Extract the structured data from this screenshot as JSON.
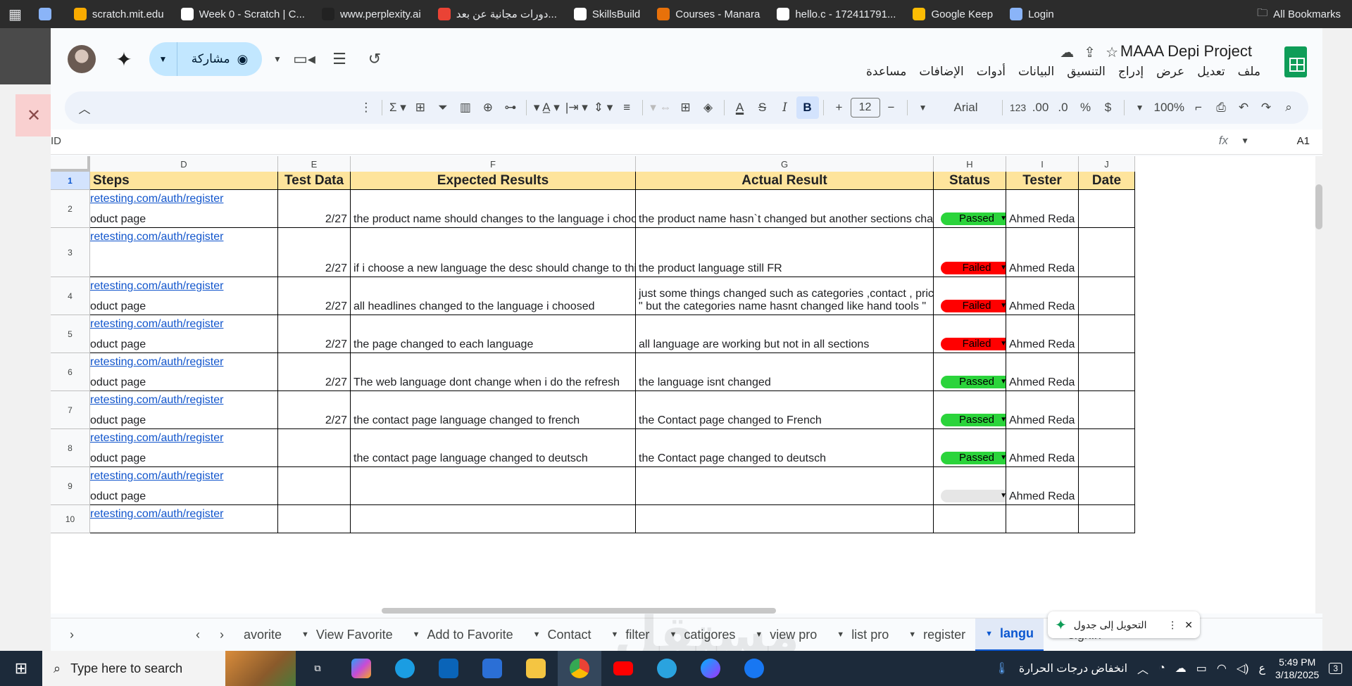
{
  "bookmarks": [
    {
      "label": "",
      "color": "#8ab4f8"
    },
    {
      "label": "scratch.mit.edu",
      "color": "#f9ab00"
    },
    {
      "label": "Week 0 - Scratch | C...",
      "color": "#ffffff"
    },
    {
      "label": "www.perplexity.ai",
      "color": "#222222"
    },
    {
      "label": "دورات مجانية عن بعد...",
      "color": "#ea4335"
    },
    {
      "label": "SkillsBuild",
      "color": "#ffffff"
    },
    {
      "label": "Courses - Manara",
      "color": "#e8710a"
    },
    {
      "label": "hello.c - 172411791...",
      "color": "#ffffff"
    },
    {
      "label": "Google Keep",
      "color": "#fbbc04"
    },
    {
      "label": "Login",
      "color": "#8ab4f8"
    }
  ],
  "all_bookmarks": "All Bookmarks",
  "header": {
    "title": "MAAA Depi Project",
    "share": "مشاركة",
    "menu": [
      "ملف",
      "تعديل",
      "عرض",
      "إدراج",
      "التنسيق",
      "البيانات",
      "أدوات",
      "الإضافات",
      "مساعدة"
    ]
  },
  "toolbar": {
    "zoom": "100%",
    "currency": "$",
    "percent": "%",
    "format123": "123",
    "font": "Arial",
    "font_size": "12",
    "bold": "B",
    "italic": "I",
    "text_color_label": "A"
  },
  "formula_bar": {
    "cell_ref": "A1",
    "value": "ID",
    "fx": "fx"
  },
  "columns": [
    {
      "letter": "D",
      "header": "Steps"
    },
    {
      "letter": "E",
      "header": "Test Data"
    },
    {
      "letter": "F",
      "header": "Expected Results"
    },
    {
      "letter": "G",
      "header": "Actual Result"
    },
    {
      "letter": "H",
      "header": "Status"
    },
    {
      "letter": "I",
      "header": "Tester"
    },
    {
      "letter": "J",
      "header": "Date"
    }
  ],
  "rows": [
    {
      "num": "2",
      "link": "retesting.com/auth/register",
      "step": "oduct page",
      "data": "2/27",
      "expected": "the product name should changes to the language i choosed",
      "actual1": "",
      "actual2": "the product name hasn`t changed but another sections changed",
      "status": "Passed",
      "tester": "Ahmed Reda"
    },
    {
      "num": "3",
      "link": "retesting.com/auth/register",
      "step": "",
      "data": "2/27",
      "expected": "if i choose a new language the desc should change to this language",
      "actual1": "",
      "actual2": "the product language still FR",
      "status": "Failed",
      "tester": "Ahmed Reda"
    },
    {
      "num": "4",
      "link": "retesting.com/auth/register",
      "step": "oduct page",
      "data": "2/27",
      "expected": "all headlines changed to the language i choosed",
      "actual1": "just some things changed such as categories ,contact , price",
      "actual2": "\" but the categories name hasnt changed like hand tools \"",
      "status": "Failed",
      "tester": "Ahmed Reda"
    },
    {
      "num": "5",
      "link": "retesting.com/auth/register",
      "step": "oduct page",
      "data": "2/27",
      "expected": "the page changed to each language",
      "actual1": "",
      "actual2": "all language are working but not in all sections",
      "status": "Failed",
      "tester": "Ahmed Reda"
    },
    {
      "num": "6",
      "link": "retesting.com/auth/register",
      "step": "oduct page",
      "data": "2/27",
      "expected": "The web language dont change when i do the refresh",
      "actual1": "",
      "actual2": "the language isnt changed",
      "status": "Passed",
      "tester": "Ahmed Reda"
    },
    {
      "num": "7",
      "link": "retesting.com/auth/register",
      "step": "oduct page",
      "data": "2/27",
      "expected": "the contact page language changed to french",
      "actual1": "",
      "actual2": "the Contact page changed to French",
      "status": "Passed",
      "tester": "Ahmed Reda"
    },
    {
      "num": "8",
      "link": "retesting.com/auth/register",
      "step": "oduct page",
      "data": "",
      "expected": "the contact page language changed to deutsch",
      "actual1": "",
      "actual2": "the Contact page changed to deutsch",
      "status": "Passed",
      "tester": "Ahmed Reda"
    },
    {
      "num": "9",
      "link": "retesting.com/auth/register",
      "step": "oduct page",
      "data": "",
      "expected": "",
      "actual1": "",
      "actual2": "",
      "status": "",
      "tester": "Ahmed Reda"
    },
    {
      "num": "10",
      "link": "retesting.com/auth/register",
      "step": "",
      "data": "",
      "expected": "",
      "actual1": "",
      "actual2": "",
      "status": "",
      "tester": ""
    }
  ],
  "sheet_tabs": [
    "avorite",
    "View Favorite",
    "Add to Favorite",
    "Contact",
    "filter",
    "catigores",
    "view pro",
    "list pro",
    "register",
    "langu",
    "signin"
  ],
  "active_tab": "langu",
  "convert_to_table": "التحويل إلى جدول",
  "watermark": "مستقل",
  "taskbar": {
    "search_placeholder": "Type here to search",
    "weather": "انخفاض درجات الحرارة",
    "lang": "ع",
    "time": "5:49 PM",
    "date": "3/18/2025",
    "notifications": "3"
  },
  "colors": {
    "passed": "#2bd43b",
    "failed": "#ff0000",
    "header_fill": "#fee49c",
    "link": "#1155cc",
    "accent": "#0b57d0"
  }
}
